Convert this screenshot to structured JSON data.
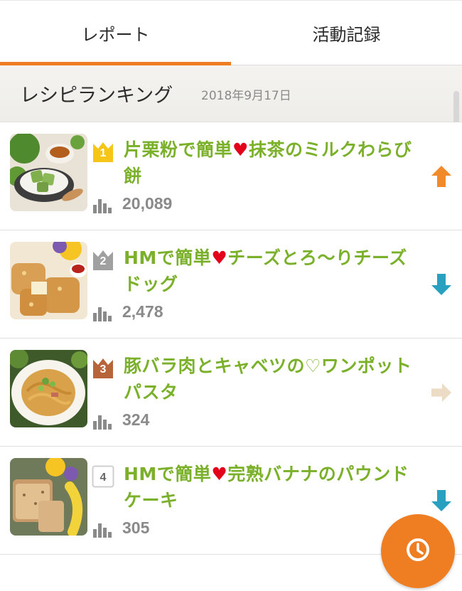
{
  "tabs": [
    {
      "label": "レポート",
      "active": true
    },
    {
      "label": "活動記録",
      "active": false
    }
  ],
  "section": {
    "title": "レシピランキング",
    "date": "2018年9月17日"
  },
  "colors": {
    "accent": "#ef7d22",
    "title_green": "#7bb02a",
    "gold": "#f5c518",
    "silver": "#a0a0a0",
    "bronze": "#b8643a",
    "trend_up": "#f08a2a",
    "trend_down": "#2aa0c0",
    "trend_flat": "#ecdcc6"
  },
  "rankings": [
    {
      "rank": "1",
      "title_a": "片栗粉で簡単",
      "heart": "♥",
      "title_b": "抹茶のミルクわらび餅",
      "views": "20,089",
      "trend": "up",
      "thumb_icon": "matcha-warabimochi-photo"
    },
    {
      "rank": "2",
      "title_a": "HMで簡単",
      "heart": "♥",
      "title_b": "チーズとろ〜りチーズドッグ",
      "views": "2,478",
      "trend": "down",
      "thumb_icon": "cheese-dog-photo"
    },
    {
      "rank": "3",
      "title_a": "豚バラ肉とキャベツの♡ワンポットパスタ",
      "heart": "",
      "title_b": "",
      "views": "324",
      "trend": "flat",
      "thumb_icon": "pasta-photo"
    },
    {
      "rank": "4",
      "title_a": "HMで簡単",
      "heart": "♥",
      "title_b": "完熟バナナのパウンドケーキ",
      "views": "305",
      "trend": "down",
      "thumb_icon": "banana-pound-cake-photo"
    }
  ],
  "fab": {
    "icon": "clock-icon"
  }
}
